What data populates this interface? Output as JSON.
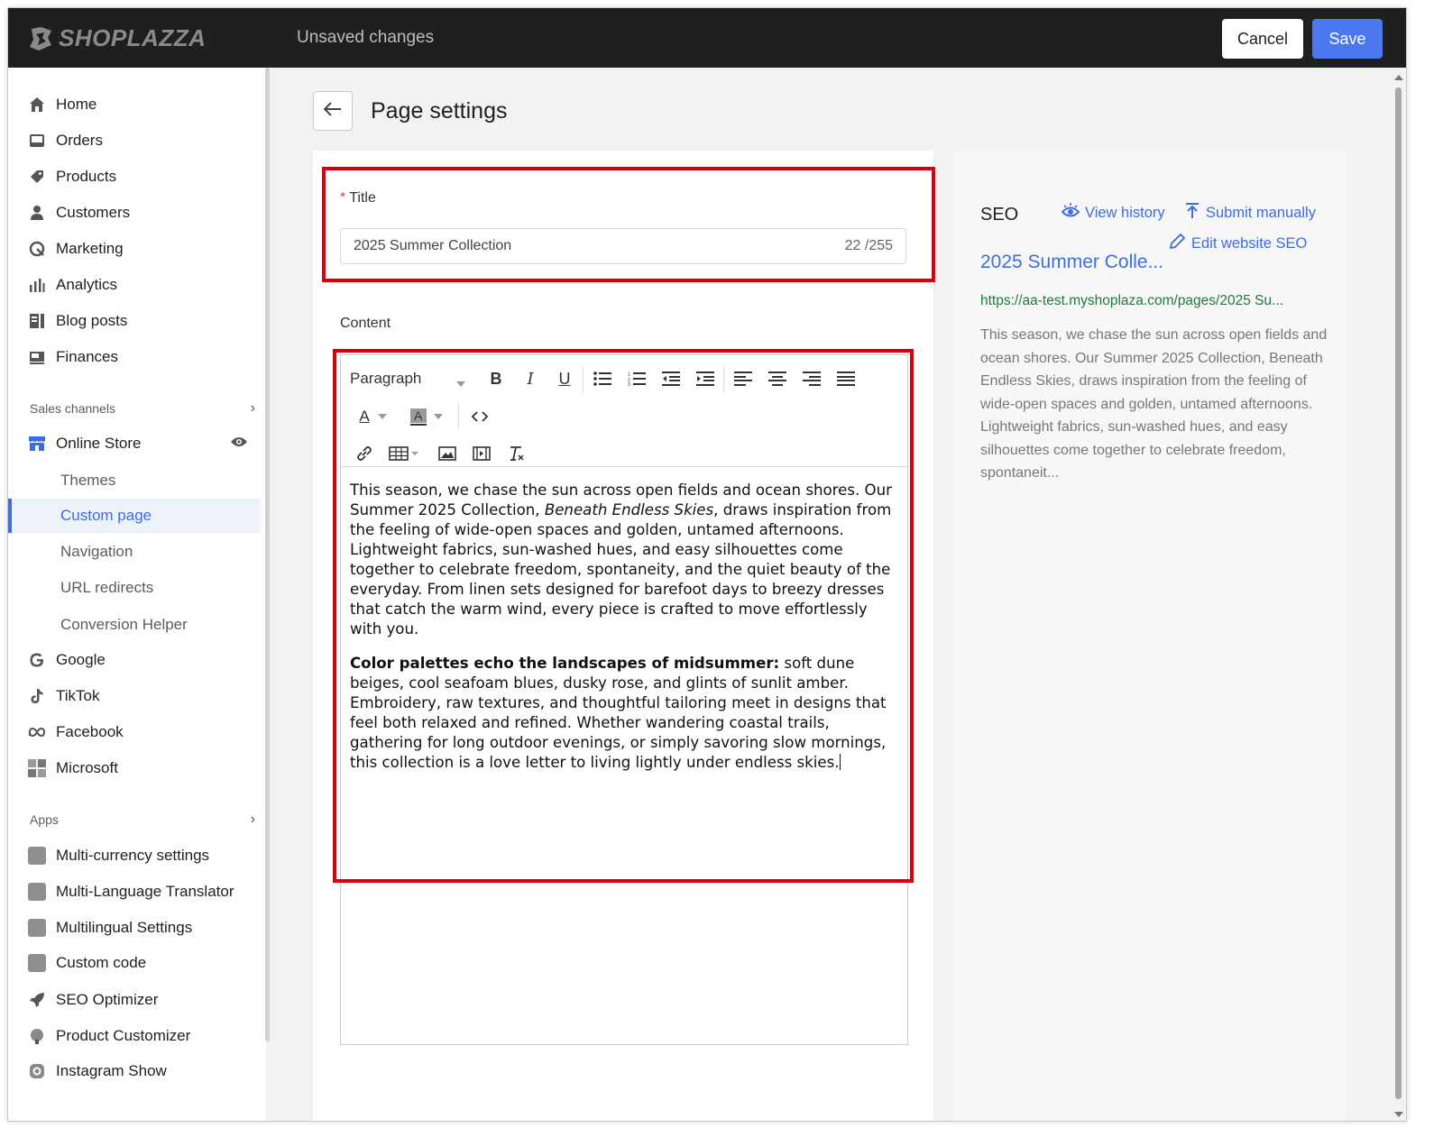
{
  "app": {
    "brand": "SHOPLAZZA",
    "status": "Unsaved changes",
    "cancel_label": "Cancel",
    "save_label": "Save",
    "save_color": "#4b78f0"
  },
  "sidebar": {
    "items": [
      {
        "label": "Home",
        "icon": "home-icon"
      },
      {
        "label": "Orders",
        "icon": "orders-icon"
      },
      {
        "label": "Products",
        "icon": "tag-icon"
      },
      {
        "label": "Customers",
        "icon": "person-icon"
      },
      {
        "label": "Marketing",
        "icon": "marketing-icon"
      },
      {
        "label": "Analytics",
        "icon": "bar-chart-icon"
      },
      {
        "label": "Blog posts",
        "icon": "blog-icon"
      },
      {
        "label": "Finances",
        "icon": "finances-icon"
      }
    ],
    "sales_channels_heading": "Sales channels",
    "online_store": "Online Store",
    "online_store_sub": [
      "Themes",
      "Custom page",
      "Navigation",
      "URL redirects",
      "Conversion Helper"
    ],
    "active_sub": "Custom page",
    "channels": [
      "Google",
      "TikTok",
      "Facebook",
      "Microsoft"
    ],
    "apps_heading": "Apps",
    "apps": [
      "Multi-currency settings",
      "Multi-Language Translator",
      "Multilingual Settings",
      "Custom code",
      "SEO Optimizer",
      "Product Customizer",
      "Instagram Show"
    ]
  },
  "main": {
    "page_title": "Page settings",
    "title_label": "Title",
    "title_value": "2025 Summer Collection",
    "title_count": "22 /255",
    "content_label": "Content",
    "toolbar": {
      "paragraph_select": "Paragraph"
    },
    "editor": {
      "p1_a": "This season, we chase the sun across open fields and ocean shores. Our Summer 2025 Collection, ",
      "p1_italic": "Beneath Endless Skies",
      "p1_b": ", draws inspiration from the feeling of wide-open spaces and golden, untamed afternoons. Lightweight fabrics, sun-washed hues, and easy silhouettes come together to celebrate freedom, spontaneity, and the quiet beauty of the everyday. From linen sets designed for barefoot days to breezy dresses that catch the warm wind, every piece is crafted to move effortlessly with you.",
      "p2_bold": "Color palettes echo the landscapes of midsummer:",
      "p2_rest": " soft dune beiges, cool seafoam blues, dusky rose, and glints of sunlit amber. Embroidery, raw textures, and thoughtful tailoring meet in designs that feel both relaxed and refined. Whether wandering coastal trails, gathering for long outdoor evenings, or simply savoring slow mornings, this collection is a love letter to living lightly under endless skies."
    }
  },
  "seo": {
    "heading": "SEO",
    "view_history": "View history",
    "submit_manually": "Submit manually",
    "edit_seo": "Edit website SEO",
    "preview_title": "2025 Summer Colle...",
    "preview_url": "https://aa-test.myshoplaza.com/pages/2025 Su...",
    "preview_description": "This season, we chase the sun across open fields and ocean shores. Our Summer 2025 Collection, Beneath Endless Skies, draws inspiration from the feeling of wide-open spaces and golden, untamed afternoons. Lightweight fabrics, sun-washed hues, and easy silhouettes come together to celebrate freedom, spontaneit...",
    "link_color": "#3c6ce6",
    "url_color": "#1d7c3a"
  },
  "annotations": {
    "highlight_color": "#d8000c"
  }
}
